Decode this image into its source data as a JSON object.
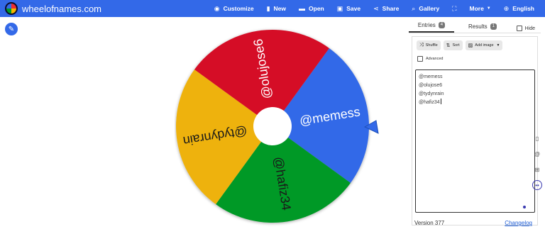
{
  "header": {
    "site_name": "wheelofnames.com",
    "menu": [
      {
        "label": "Customize",
        "icon": "palette-icon",
        "glyph": "◉"
      },
      {
        "label": "New",
        "icon": "new-document-icon",
        "glyph": "▮"
      },
      {
        "label": "Open",
        "icon": "folder-icon",
        "glyph": "▬"
      },
      {
        "label": "Save",
        "icon": "save-icon",
        "glyph": "▣"
      },
      {
        "label": "Share",
        "icon": "share-icon",
        "glyph": "⋖"
      },
      {
        "label": "Gallery",
        "icon": "search-icon",
        "glyph": "⌕"
      },
      {
        "label": "",
        "icon": "fullscreen-icon",
        "glyph": "⛶"
      },
      {
        "label": "More",
        "icon": "more-caret-icon",
        "glyph": "▼"
      },
      {
        "label": "English",
        "icon": "globe-icon",
        "glyph": "⊕"
      }
    ],
    "bg_color": "#3369e8"
  },
  "wheel": {
    "slices": [
      {
        "label": "@memess",
        "color": "#3369e8"
      },
      {
        "label": "@hafiz34",
        "color": "#009925"
      },
      {
        "label": "@tydynrain",
        "color": "#eeb211"
      },
      {
        "label": "@olujose6",
        "color": "#d50f25"
      }
    ]
  },
  "panel": {
    "tabs": {
      "entries_label": "Entries",
      "entries_count": "4",
      "results_label": "Results",
      "results_count": "1"
    },
    "hide_label": "Hide",
    "toolbar": {
      "shuffle_label": "Shuffle",
      "sort_label": "Sort",
      "add_image_label": "Add image"
    },
    "advanced_label": "Advanced",
    "entries": [
      "@memess",
      "@olujose6",
      "@tydynrain",
      "@hafiz34"
    ],
    "version": "Version 377",
    "changelog": "Changelog"
  }
}
